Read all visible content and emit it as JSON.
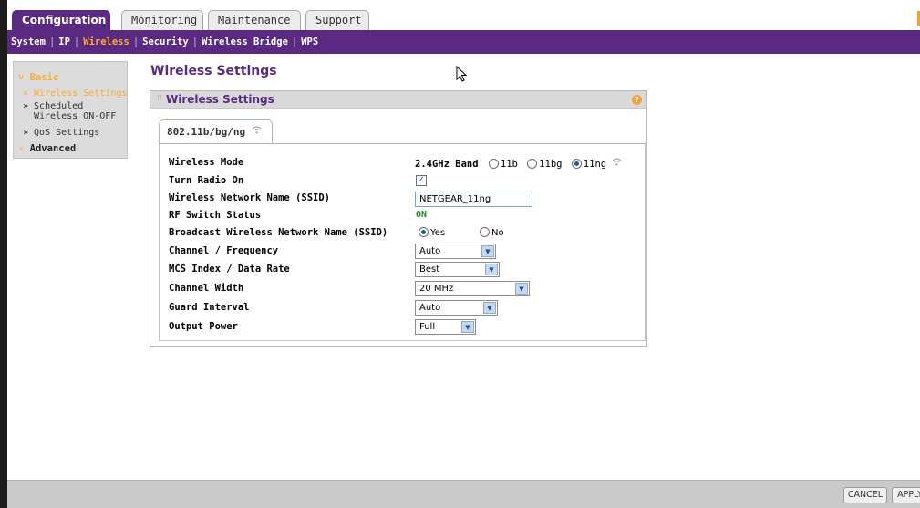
{
  "tabs": [
    {
      "label": "Configuration"
    },
    {
      "label": "Monitoring"
    },
    {
      "label": "Maintenance"
    },
    {
      "label": "Support"
    }
  ],
  "submenu": [
    "System",
    "IP",
    "Wireless",
    "Security",
    "Wireless Bridge",
    "WPS"
  ],
  "sidebar": {
    "basic": "Basic",
    "items": [
      "» Wireless Settings",
      "» Scheduled",
      "Wireless ON-OFF",
      "» QoS Settings"
    ],
    "advanced": "Advanced"
  },
  "page": {
    "title": "Wireless Settings"
  },
  "panel": {
    "title": "Wireless Settings",
    "help": "?",
    "mode_tab": "802.11b/bg/ng"
  },
  "fields": {
    "wireless_mode": {
      "label": "Wireless Mode",
      "band": "2.4GHz Band",
      "options": [
        "11b",
        "11bg",
        "11ng"
      ],
      "selected": "11ng"
    },
    "turn_radio_on": {
      "label": "Turn Radio On",
      "mark": "✓"
    },
    "ssid": {
      "label": "Wireless Network Name (SSID)",
      "value": "NETGEAR_11ng"
    },
    "rf_switch": {
      "label": "RF Switch Status",
      "value": "ON"
    },
    "broadcast_ssid": {
      "label": "Broadcast Wireless Network Name (SSID)",
      "yes": "Yes",
      "no": "No",
      "selected": "Yes"
    },
    "channel": {
      "label": "Channel / Frequency",
      "value": "Auto"
    },
    "mcs": {
      "label": "MCS Index / Data Rate",
      "value": "Best"
    },
    "channel_width": {
      "label": "Channel Width",
      "value": "20 MHz"
    },
    "guard_interval": {
      "label": "Guard Interval",
      "value": "Auto"
    },
    "output_power": {
      "label": "Output Power",
      "value": "Full"
    }
  },
  "footer": {
    "cancel": "CANCEL",
    "apply": "APPLY"
  },
  "colors": {
    "brand": "#5a2a82",
    "accent": "#ffab34",
    "status_on": "#1f8a1f"
  }
}
